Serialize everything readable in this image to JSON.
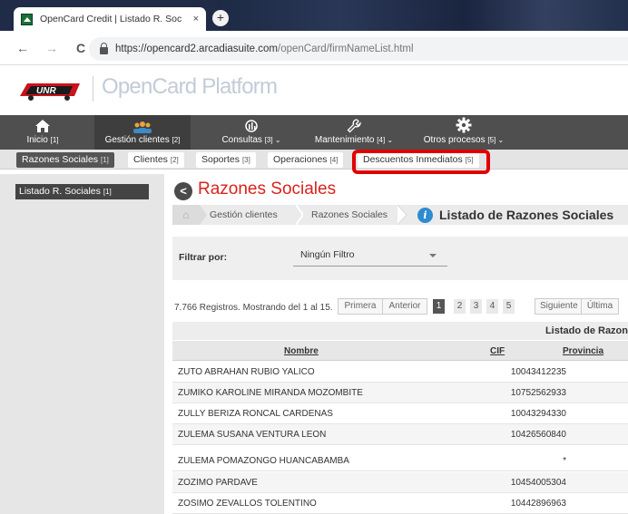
{
  "browser": {
    "tab_title": "OpenCard Credit | Listado R. Soc",
    "tab_close": "×",
    "new_tab": "+",
    "url_domain": "https://opencard2.arcadiasuite.com",
    "url_path": "/openCard/firmNameList.html",
    "nav": {
      "back": "←",
      "forward": "→",
      "reload": "C"
    }
  },
  "app": {
    "brand_name": "OpenCard Platform",
    "colors": {
      "accent": "#d9231c",
      "nav_bg": "#4f4f4f",
      "highlight": "#e00000"
    }
  },
  "main_nav": [
    {
      "label": "Inicio",
      "badge": "[1]",
      "icon": "home-icon"
    },
    {
      "label": "Gestión clientes",
      "badge": "[2]",
      "icon": "people-icon"
    },
    {
      "label": "Consultas",
      "badge": "[3] ⌄",
      "icon": "chart-icon"
    },
    {
      "label": "Mantenimiento",
      "badge": "[4] ⌄",
      "icon": "wrench-icon"
    },
    {
      "label": "Otros procesos",
      "badge": "[5] ⌄",
      "icon": "gear-icon"
    }
  ],
  "sub_nav": [
    {
      "label": "Razones Sociales",
      "badge": "[1]"
    },
    {
      "label": "Clientes",
      "badge": "[2]"
    },
    {
      "label": "Soportes",
      "badge": "[3]"
    },
    {
      "label": "Operaciones",
      "badge": "[4]"
    },
    {
      "label": "Descuentos Inmediatos",
      "badge": "[5]"
    }
  ],
  "sidebar": {
    "item": {
      "label": "Listado R. Sociales",
      "badge": "[1]"
    }
  },
  "content": {
    "back": "<",
    "title": "Razones Sociales",
    "breadcrumb": [
      "Gestión clientes",
      "Razones Sociales"
    ],
    "current": "Listado de Razones Sociales",
    "filter": {
      "label": "Filtrar por:",
      "value": "Ningún Filtro"
    },
    "records_text": "7.766 Registros. Mostrando del 1 al 15.",
    "pagination": {
      "first": "Primera",
      "prev": "Anterior",
      "pages": [
        "1",
        "2",
        "3",
        "4",
        "5"
      ],
      "current_page": "1",
      "next": "Siguiente",
      "last": "Última"
    },
    "table": {
      "caption": "Listado de Razon",
      "columns": [
        "Nombre",
        "CIF",
        "Provincia"
      ],
      "rows": [
        {
          "nombre": "ZUTO ABRAHAN RUBIO YALICO",
          "cif": "10043412235"
        },
        {
          "nombre": "ZUMIKO KAROLINE MIRANDA MOZOMBITE",
          "cif": "10752562933"
        },
        {
          "nombre": "ZULLY BERIZA RONCAL CARDENAS",
          "cif": "10043294330"
        },
        {
          "nombre": "ZULEMA SUSANA VENTURA LEON",
          "cif": "10426560840"
        },
        {
          "nombre": "ZULEMA POMAZONGO HUANCABAMBA",
          "cif": "*"
        },
        {
          "nombre": "ZOZIMO PARDAVE",
          "cif": "10454005304"
        },
        {
          "nombre": "ZOSIMO ZEVALLOS TOLENTINO",
          "cif": "10442896963"
        }
      ]
    }
  }
}
